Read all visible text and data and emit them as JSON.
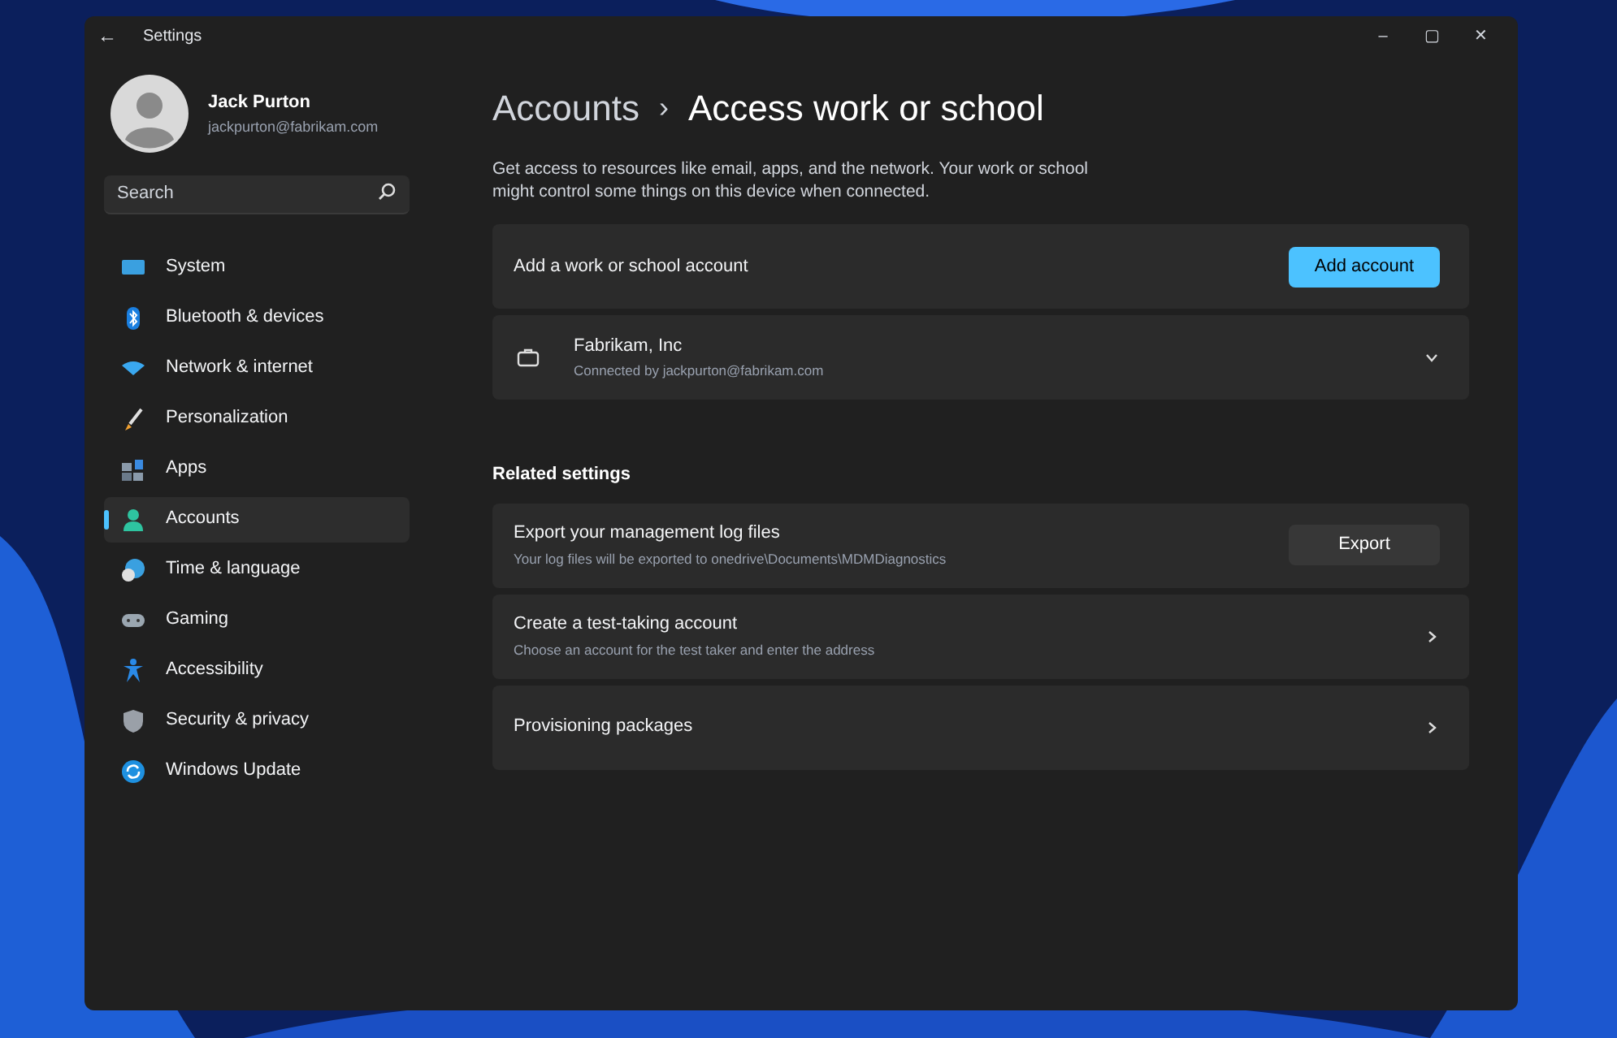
{
  "window": {
    "title": "Settings",
    "back": "←",
    "controls": [
      "–",
      "▢",
      "✕"
    ]
  },
  "user": {
    "name": "Jack Purton",
    "email": "jackpurton@fabrikam.com"
  },
  "search": {
    "placeholder": "Search"
  },
  "sidebar": {
    "items": [
      {
        "label": "System",
        "selected": false
      },
      {
        "label": "Bluetooth & devices",
        "selected": false
      },
      {
        "label": "Network & internet",
        "selected": false
      },
      {
        "label": "Personalization",
        "selected": false
      },
      {
        "label": "Apps",
        "selected": false
      },
      {
        "label": "Accounts",
        "selected": true
      },
      {
        "label": "Time & language",
        "selected": false
      },
      {
        "label": "Gaming",
        "selected": false
      },
      {
        "label": "Accessibility",
        "selected": false
      },
      {
        "label": "Security & privacy",
        "selected": false
      },
      {
        "label": "Windows Update",
        "selected": false
      }
    ]
  },
  "breadcrumb": {
    "parent": "Accounts",
    "separator": "›",
    "current": "Access work or school"
  },
  "description": "Get access to resources like email, apps, and the network. Your work or school might control some things on this device when connected.",
  "cards": [
    {
      "kind": "action",
      "title": "Add a work or school account",
      "button": "Add account",
      "accent": true
    },
    {
      "kind": "expander",
      "title": "Fabrikam, Inc",
      "subtitle": "Connected by jackpurton@fabrikam.com",
      "expanded": false
    }
  ],
  "related": {
    "heading": "Related settings",
    "cards": [
      {
        "kind": "action",
        "title": "Export your management log files",
        "subtitle": "Your log files will be exported to onedrive\\Documents\\MDMDiagnostics",
        "button": "Export",
        "accent": false
      },
      {
        "kind": "link",
        "title": "Create a test-taking account",
        "subtitle": "Choose an account for the test taker and enter the address"
      },
      {
        "kind": "link",
        "title": "Provisioning packages"
      }
    ]
  }
}
